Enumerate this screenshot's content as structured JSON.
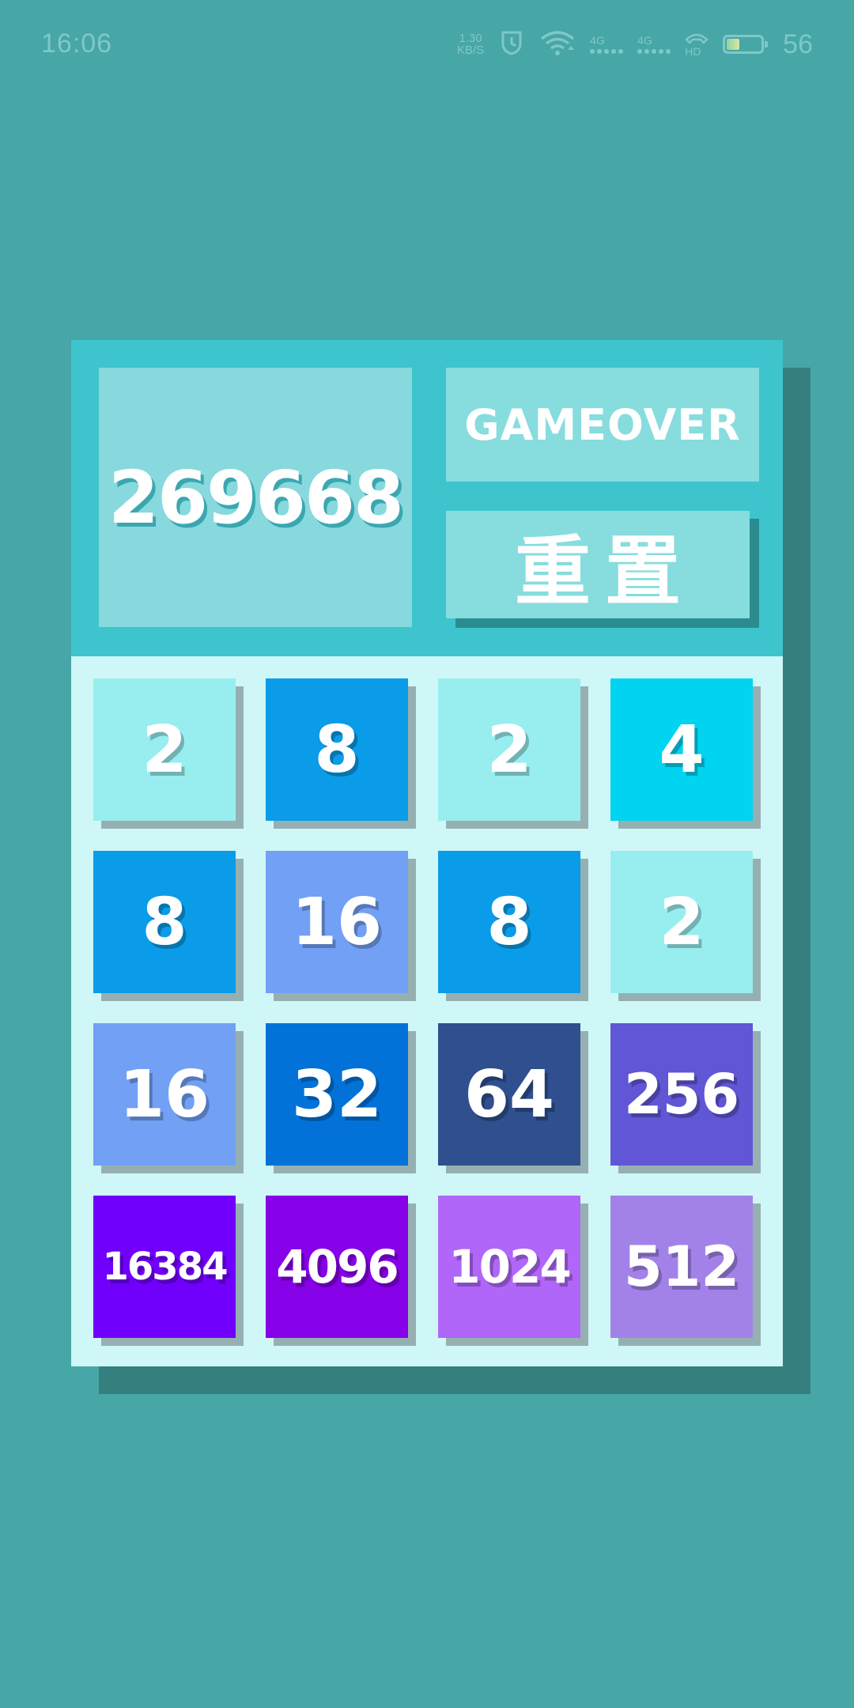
{
  "status_bar": {
    "time": "16:06",
    "net_speed_value": "1.30",
    "net_speed_unit": "KB/S",
    "sim1_label": "4G",
    "sim2_label": "4G",
    "hd_label": "HD",
    "battery_level": "56",
    "color": "#7fc8c8"
  },
  "game": {
    "score": "269668",
    "status": "GAMEOVER",
    "reset_label": "重置",
    "tiles": [
      {
        "value": "2",
        "color": "#98eeef"
      },
      {
        "value": "8",
        "color": "#0a9ce8"
      },
      {
        "value": "2",
        "color": "#98eeef"
      },
      {
        "value": "4",
        "color": "#00d4f0"
      },
      {
        "value": "8",
        "color": "#0a9ce8"
      },
      {
        "value": "16",
        "color": "#72a0f5"
      },
      {
        "value": "8",
        "color": "#0a9ce8"
      },
      {
        "value": "2",
        "color": "#98eeef"
      },
      {
        "value": "16",
        "color": "#72a0f5"
      },
      {
        "value": "32",
        "color": "#0272d8"
      },
      {
        "value": "64",
        "color": "#2f4f8f"
      },
      {
        "value": "256",
        "color": "#6056d6"
      },
      {
        "value": "16384",
        "color": "#7000fb"
      },
      {
        "value": "4096",
        "color": "#8600e8"
      },
      {
        "value": "1024",
        "color": "#b066f8"
      },
      {
        "value": "512",
        "color": "#a282e8"
      }
    ]
  },
  "colors": {
    "background": "#47a6a6",
    "header": "#3ec4cc",
    "grid_background": "#cff7f7",
    "panel": "#87d9dd"
  }
}
